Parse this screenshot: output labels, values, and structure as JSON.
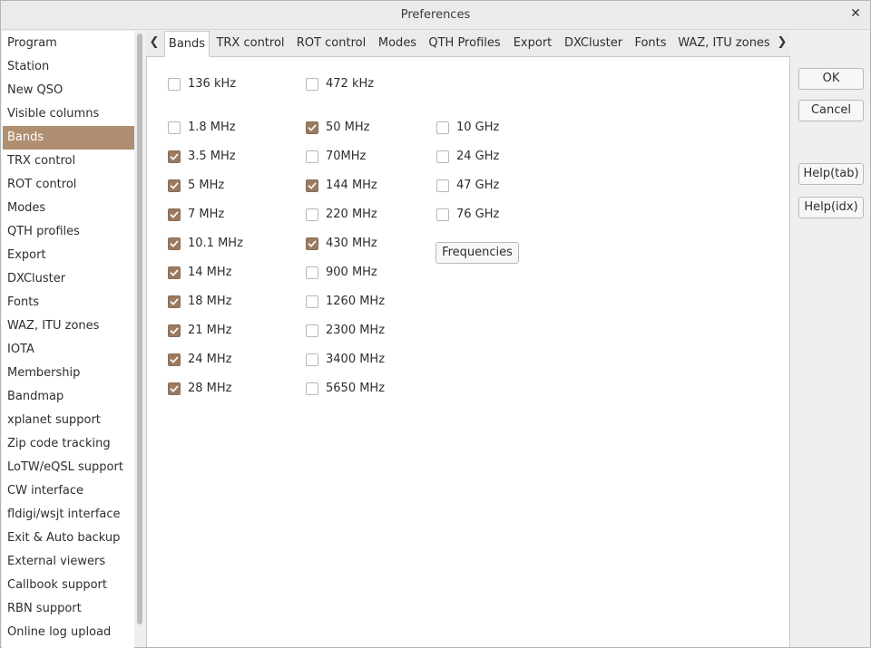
{
  "window": {
    "title": "Preferences"
  },
  "sidebar": {
    "selected_index": 4,
    "items": [
      {
        "label": "Program"
      },
      {
        "label": "Station"
      },
      {
        "label": "New QSO"
      },
      {
        "label": "Visible columns"
      },
      {
        "label": "Bands"
      },
      {
        "label": "TRX control"
      },
      {
        "label": "ROT control"
      },
      {
        "label": "Modes"
      },
      {
        "label": "QTH profiles"
      },
      {
        "label": "Export"
      },
      {
        "label": "DXCluster"
      },
      {
        "label": "Fonts"
      },
      {
        "label": "WAZ, ITU zones"
      },
      {
        "label": "IOTA"
      },
      {
        "label": "Membership"
      },
      {
        "label": "Bandmap"
      },
      {
        "label": "xplanet support"
      },
      {
        "label": "Zip code tracking"
      },
      {
        "label": "LoTW/eQSL support"
      },
      {
        "label": "CW interface"
      },
      {
        "label": "fldigi/wsjt interface"
      },
      {
        "label": "Exit & Auto backup"
      },
      {
        "label": "External viewers"
      },
      {
        "label": "Callbook support"
      },
      {
        "label": "RBN support"
      },
      {
        "label": "Online log upload"
      }
    ]
  },
  "tabs": [
    {
      "label": "Bands",
      "active": true
    },
    {
      "label": "TRX control"
    },
    {
      "label": "ROT control"
    },
    {
      "label": "Modes"
    },
    {
      "label": "QTH Profiles"
    },
    {
      "label": "Export"
    },
    {
      "label": "DXCluster"
    },
    {
      "label": "Fonts"
    },
    {
      "label": "WAZ, ITU zones"
    }
  ],
  "bands": [
    {
      "label": "136 kHz",
      "checked": false
    },
    {
      "label": "472 kHz",
      "checked": false
    },
    {
      "label": "1.8 MHz",
      "checked": false
    },
    {
      "label": "3.5 MHz",
      "checked": true
    },
    {
      "label": "5 MHz",
      "checked": true
    },
    {
      "label": "7 MHz",
      "checked": true
    },
    {
      "label": "10.1 MHz",
      "checked": true
    },
    {
      "label": "14 MHz",
      "checked": true
    },
    {
      "label": "18 MHz",
      "checked": true
    },
    {
      "label": "21 MHz",
      "checked": true
    },
    {
      "label": "24 MHz",
      "checked": true
    },
    {
      "label": "28 MHz",
      "checked": true
    },
    {
      "label": "50 MHz",
      "checked": true
    },
    {
      "label": "70MHz",
      "checked": false
    },
    {
      "label": "144 MHz",
      "checked": true
    },
    {
      "label": "220 MHz",
      "checked": false
    },
    {
      "label": "430 MHz",
      "checked": true
    },
    {
      "label": "900 MHz",
      "checked": false
    },
    {
      "label": "1260 MHz",
      "checked": false
    },
    {
      "label": "2300 MHz",
      "checked": false
    },
    {
      "label": "3400 MHz",
      "checked": false
    },
    {
      "label": "5650 MHz",
      "checked": false
    },
    {
      "label": "10 GHz",
      "checked": false
    },
    {
      "label": "24 GHz",
      "checked": false
    },
    {
      "label": "47 GHz",
      "checked": false
    },
    {
      "label": "76 GHz",
      "checked": false
    }
  ],
  "buttons": {
    "frequencies": "Frequencies",
    "ok": "OK",
    "cancel": "Cancel",
    "help_tab": "Help(tab)",
    "help_idx": "Help(idx)"
  },
  "icons": {
    "close": "close-icon",
    "tab_left": "chevron-left-icon",
    "tab_right": "chevron-right-icon",
    "check": "check-icon"
  },
  "colors": {
    "accent": "#b08e71",
    "checkbox_checked": "#9a7b61"
  }
}
